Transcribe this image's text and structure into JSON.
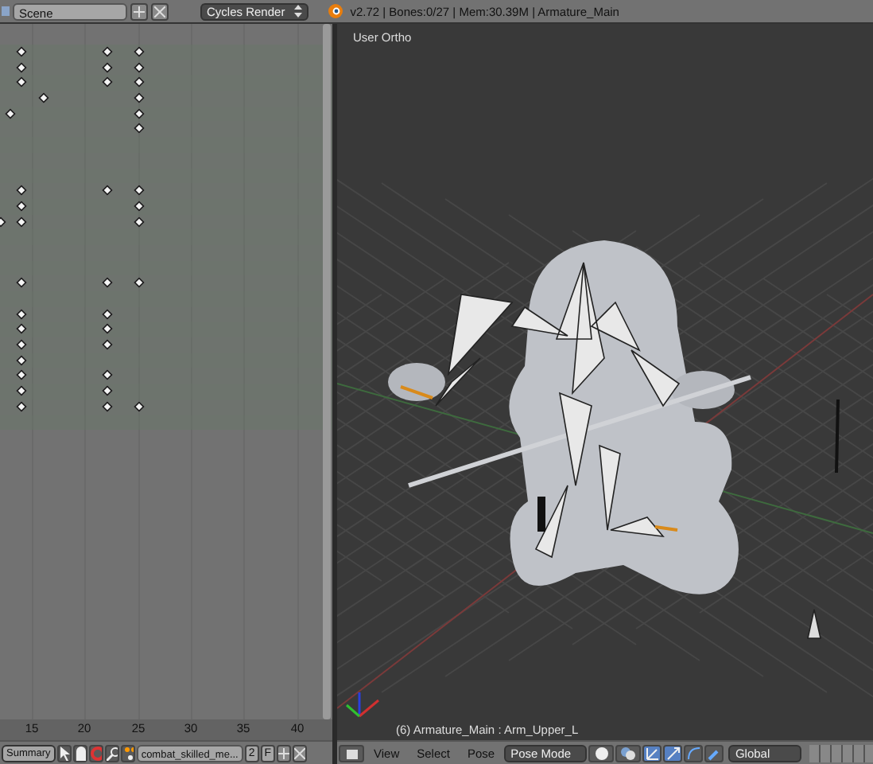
{
  "top_header": {
    "scene": "Scene",
    "render_engine": "Cycles Render",
    "stats": "v2.72 | Bones:0/27 | Mem:30.39M | Armature_Main"
  },
  "dopesheet": {
    "keyframe_rows": [
      {
        "keys": [
          false,
          false,
          true,
          false,
          true,
          true
        ]
      },
      {
        "keys": [
          false,
          false,
          true,
          false,
          true,
          true
        ]
      },
      {
        "keys": [
          false,
          false,
          true,
          false,
          true,
          true
        ]
      },
      {
        "keys": [
          false,
          false,
          false,
          true,
          false,
          true
        ]
      },
      {
        "keys": [
          false,
          true,
          false,
          false,
          false,
          true
        ]
      },
      {
        "keys": [
          false,
          false,
          false,
          false,
          false,
          true
        ]
      },
      {
        "keys": [
          false,
          false,
          false,
          false,
          false,
          false
        ]
      },
      {
        "keys": [
          false,
          false,
          false,
          false,
          false,
          false
        ]
      },
      {
        "keys": [
          false,
          false,
          false,
          false,
          false,
          false
        ]
      },
      {
        "keys": [
          false,
          false,
          true,
          false,
          true,
          true
        ]
      },
      {
        "keys": [
          false,
          false,
          true,
          false,
          false,
          true
        ]
      },
      {
        "keys": [
          true,
          false,
          true,
          false,
          false,
          true
        ]
      },
      {
        "keys": [
          false,
          false,
          false,
          false,
          false,
          false
        ]
      },
      {
        "keys": [
          false,
          false,
          false,
          false,
          false,
          false
        ]
      },
      {
        "keys": [
          false,
          false,
          false,
          false,
          false,
          false
        ]
      },
      {
        "keys": [
          false,
          false,
          true,
          false,
          true,
          true
        ]
      },
      {
        "keys": [
          false,
          false,
          false,
          false,
          false,
          false
        ]
      },
      {
        "keys": [
          false,
          false,
          true,
          false,
          true,
          false
        ]
      },
      {
        "keys": [
          false,
          false,
          true,
          false,
          true,
          false
        ]
      },
      {
        "keys": [
          false,
          false,
          true,
          false,
          true,
          false
        ]
      },
      {
        "keys": [
          false,
          false,
          true,
          false,
          false,
          false
        ]
      },
      {
        "keys": [
          false,
          false,
          true,
          false,
          true,
          false
        ]
      },
      {
        "keys": [
          false,
          false,
          true,
          false,
          true,
          false
        ]
      },
      {
        "keys": [
          false,
          false,
          true,
          false,
          true,
          true
        ]
      },
      {
        "keys": [
          false,
          false,
          false,
          false,
          false,
          false
        ]
      }
    ],
    "ruler": [
      "15",
      "20",
      "25",
      "30",
      "35",
      "40"
    ],
    "header": {
      "mode": "Summary",
      "action": "combat_skilled_me...",
      "users": "2",
      "fake_user": "F"
    }
  },
  "viewport": {
    "view_name": "User Ortho",
    "object_info": "(6) Armature_Main : Arm_Upper_L",
    "header": {
      "menus": [
        "View",
        "Select",
        "Pose"
      ],
      "mode": "Pose Mode",
      "orientation": "Global"
    }
  }
}
